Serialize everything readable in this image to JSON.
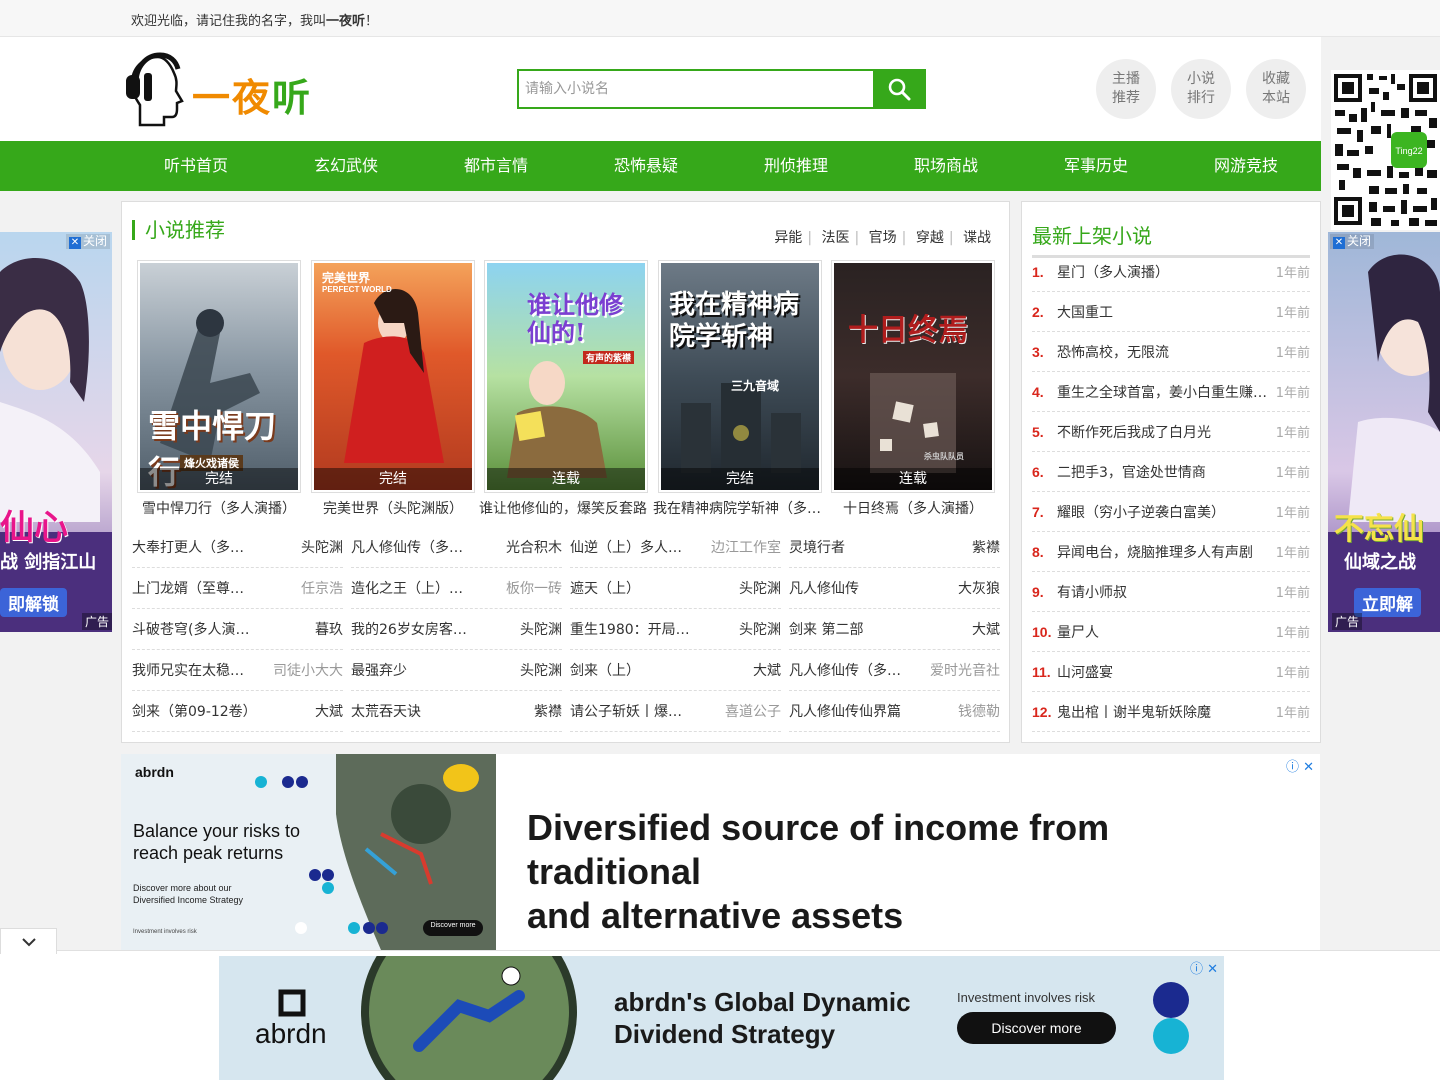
{
  "topbar": {
    "welcome_prefix": "欢迎光临，请记住我的名字，我叫",
    "welcome_name": "一夜听",
    "welcome_suffix": "！"
  },
  "logo": {
    "text_1": "一",
    "text_2": "夜",
    "text_3": "听"
  },
  "search": {
    "placeholder": "请输入小说名"
  },
  "header_buttons": [
    {
      "line1": "主播",
      "line2": "推荐"
    },
    {
      "line1": "小说",
      "line2": "排行"
    },
    {
      "line1": "收藏",
      "line2": "本站"
    }
  ],
  "nav": [
    "听书首页",
    "玄幻武侠",
    "都市言情",
    "恐怖悬疑",
    "刑侦推理",
    "职场商战",
    "军事历史",
    "网游竞技"
  ],
  "qr": {
    "badge": "Ting22"
  },
  "side_ads": {
    "close_label": "关闭",
    "ad_label": "广告",
    "left": {
      "line1": "仙心",
      "line2": "战 剑指江山",
      "line3": "即解锁"
    },
    "right": {
      "line1": "不忘仙",
      "line2": "仙域之战",
      "line3": "立即解"
    }
  },
  "recommend": {
    "title": "小说推荐",
    "tags": [
      "异能",
      "法医",
      "官场",
      "穿越",
      "谍战"
    ],
    "covers": [
      {
        "title": "雪中悍刀行（多人演播）",
        "status": "完结",
        "art": "雪中悍刀行",
        "sub": "烽火戏诸侯"
      },
      {
        "title": "完美世界（头陀渊版）",
        "status": "完结",
        "art": "完美世界",
        "sub": "PERFECT WORLD"
      },
      {
        "title": "谁让他修仙的，爆笑反套路",
        "status": "连载",
        "art": "谁让他修仙的!",
        "sub": "有声的紫襟"
      },
      {
        "title": "我在精神病院学斩神（多…",
        "status": "完结",
        "art": "我在精神病院学斩神",
        "sub": "三九音域"
      },
      {
        "title": "十日终焉（多人演播）",
        "status": "连载",
        "art": "十日终焉",
        "sub": "杀虫队队员"
      }
    ],
    "list_cols": [
      [
        {
          "t": "大奉打更人（多…",
          "a": "头陀渊",
          "gray": false
        },
        {
          "t": "上门龙婿（至尊…",
          "a": "任京浩",
          "gray": true
        },
        {
          "t": "斗破苍穹(多人演…",
          "a": "暮玖",
          "gray": false
        },
        {
          "t": "我师兄实在太稳…",
          "a": "司徒小大大",
          "gray": true
        },
        {
          "t": "剑来（第09-12卷）",
          "a": "大斌",
          "gray": false
        }
      ],
      [
        {
          "t": "凡人修仙传（多…",
          "a": "光合积木",
          "gray": false
        },
        {
          "t": "造化之王（上）…",
          "a": "板你一砖",
          "gray": true
        },
        {
          "t": "我的26岁女房客…",
          "a": "头陀渊",
          "gray": false
        },
        {
          "t": "最强弃少",
          "a": "头陀渊",
          "gray": false
        },
        {
          "t": "太荒吞天诀",
          "a": "紫襟",
          "gray": false
        }
      ],
      [
        {
          "t": "仙逆（上）多人…",
          "a": "边江工作室",
          "gray": true
        },
        {
          "t": "遮天（上）",
          "a": "头陀渊",
          "gray": false
        },
        {
          "t": "重生1980：开局…",
          "a": "头陀渊",
          "gray": false
        },
        {
          "t": "剑来（上）",
          "a": "大斌",
          "gray": false
        },
        {
          "t": "请公子斩妖丨爆…",
          "a": "喜道公子",
          "gray": true
        }
      ],
      [
        {
          "t": "灵境行者",
          "a": "紫襟",
          "gray": false
        },
        {
          "t": "凡人修仙传",
          "a": "大灰狼",
          "gray": false
        },
        {
          "t": "剑来 第二部",
          "a": "大斌",
          "gray": false
        },
        {
          "t": "凡人修仙传（多…",
          "a": "爱时光音社",
          "gray": true
        },
        {
          "t": "凡人修仙传仙界篇",
          "a": "钱德勒",
          "gray": true
        }
      ]
    ]
  },
  "latest": {
    "title": "最新上架小说",
    "items": [
      {
        "n": "1.",
        "t": "星门（多人演播）",
        "d": "1年前"
      },
      {
        "n": "2.",
        "t": "大国重工",
        "d": "1年前"
      },
      {
        "n": "3.",
        "t": "恐怖高校，无限流",
        "d": "1年前"
      },
      {
        "n": "4.",
        "t": "重生之全球首富，姜小白重生赚…",
        "d": "1年前"
      },
      {
        "n": "5.",
        "t": "不断作死后我成了白月光",
        "d": "1年前"
      },
      {
        "n": "6.",
        "t": "二把手3，官途处世情商",
        "d": "1年前"
      },
      {
        "n": "7.",
        "t": "耀眼（穷小子逆袭白富美）",
        "d": "1年前"
      },
      {
        "n": "8.",
        "t": "异闻电台，烧脑推理多人有声剧",
        "d": "1年前"
      },
      {
        "n": "9.",
        "t": "有请小师叔",
        "d": "1年前"
      },
      {
        "n": "10.",
        "t": "量尸人",
        "d": "1年前"
      },
      {
        "n": "11.",
        "t": "山河盛宴",
        "d": "1年前"
      },
      {
        "n": "12.",
        "t": "鬼出棺丨谢半鬼斩妖除魔",
        "d": "1年前"
      }
    ]
  },
  "ad_mid": {
    "brand": "abrdn",
    "tagline_1": "Balance your risks to",
    "tagline_2": "reach peak returns",
    "small_1": "Discover more about our",
    "small_2": "Diversified Income Strategy",
    "btn": "Discover more",
    "risk": "Investment involves risk",
    "headline_1": "Diversified source of income from traditional",
    "headline_2": "and alternative assets"
  },
  "ad_bottom": {
    "brand": "abrdn",
    "title_1": "abrdn's Global Dynamic",
    "title_2": "Dividend Strategy",
    "risk": "Investment involves risk",
    "btn": "Discover more"
  },
  "colors": {
    "brand_green": "#36a81a",
    "rank_red": "#d9261c",
    "logo_orange": "#f08a00"
  }
}
